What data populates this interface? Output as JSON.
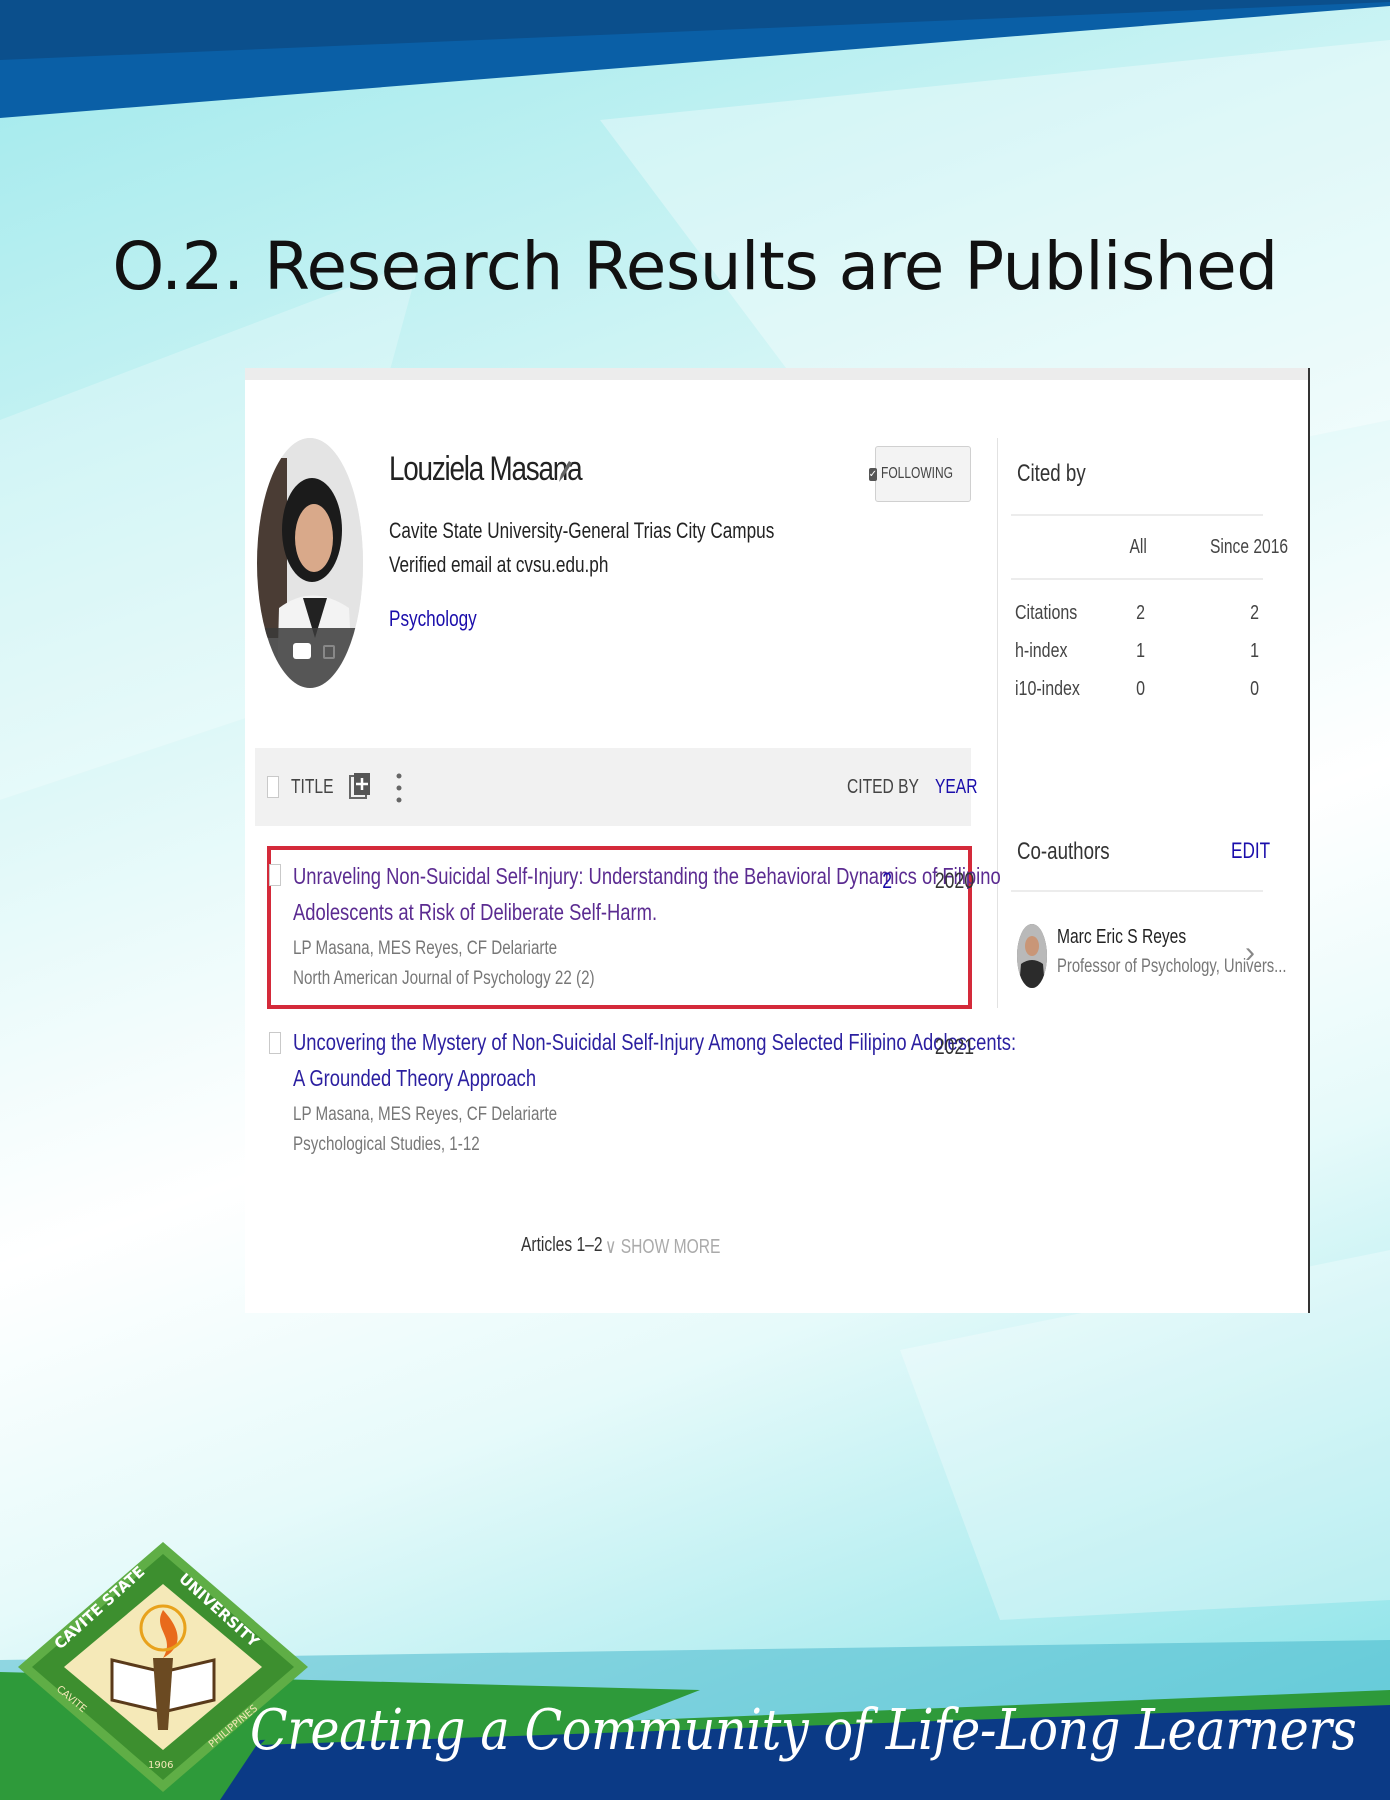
{
  "slide": {
    "title": "O.2. Research Results are Published",
    "tagline": "Creating a Community of Life-Long Learners",
    "logo": {
      "text_top": "CAVITE STATE UNIVERSITY",
      "text_bottom": "CAVITE · PHILIPPINES",
      "year": "1906"
    }
  },
  "profile": {
    "name": "Louziela Masana",
    "affiliation": "Cavite State University-General Trias City Campus",
    "email": "Verified email at cvsu.edu.ph",
    "interest": "Psychology",
    "follow_label": "FOLLOWING",
    "icons": [
      "camera-icon",
      "edit-pencil-icon"
    ]
  },
  "cited_by": {
    "title": "Cited by",
    "columns": [
      "All",
      "Since 2016"
    ],
    "rows": [
      {
        "label": "Citations",
        "all": "2",
        "since": "2"
      },
      {
        "label": "h-index",
        "all": "1",
        "since": "1"
      },
      {
        "label": "i10-index",
        "all": "0",
        "since": "0"
      }
    ]
  },
  "table": {
    "col_title": "TITLE",
    "col_cited": "CITED BY",
    "col_year": "YEAR"
  },
  "articles": [
    {
      "title_line1": "Unraveling Non-Suicidal Self-Injury: Understanding the Behavioral Dynamics of Filipino",
      "title_line2": "Adolescents at Risk of Deliberate Self-Harm.",
      "authors": "LP Masana, MES Reyes, CF Delariarte",
      "venue": "North American Journal of Psychology 22 (2)",
      "cited_by": "2",
      "year": "2020"
    },
    {
      "title_line1": "Uncovering the Mystery of Non-Suicidal Self-Injury Among Selected Filipino Adolescents:",
      "title_line2": "A Grounded Theory Approach",
      "authors": "LP Masana, MES Reyes, CF Delariarte",
      "venue": "Psychological Studies, 1-12",
      "cited_by": "",
      "year": "2021"
    }
  ],
  "pager": {
    "range": "Articles 1–2",
    "show_more": "SHOW MORE"
  },
  "coauthors": {
    "title": "Co-authors",
    "edit_label": "EDIT",
    "items": [
      {
        "name": "Marc Eric S Reyes",
        "desc": "Professor of Psychology, Univers..."
      }
    ]
  },
  "colors": {
    "link_blue": "#1a0dab",
    "visited_purple": "#5b2b91",
    "highlight_red": "#d42a3a",
    "banner_blue": "#0a5fa6",
    "footer_green": "#2e9a3a",
    "footer_navy": "#0b3a86"
  }
}
